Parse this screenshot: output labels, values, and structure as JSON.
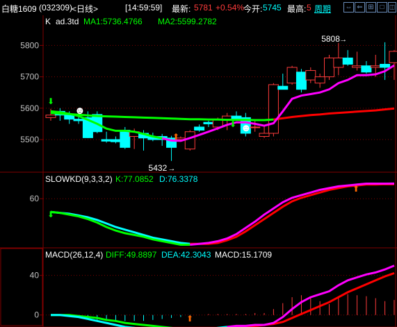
{
  "header": {
    "symbol": "白糖1609",
    "code": "(032309)",
    "period_tab": "<日线>",
    "time": "[14:59:59]",
    "latest_label": "最新:",
    "latest_value": "5781",
    "change": "+0.54%",
    "open_label": "今开:",
    "open_value": "5745",
    "high_label": "最高:",
    "high_value": "5",
    "period_link": "周期",
    "window_icons": [
      "arrows-left-right-icon",
      "back-icon",
      "grid-icon",
      "square-icon",
      "restore-icon",
      "close-icon"
    ]
  },
  "colors": {
    "up": "#ff3b3b",
    "down": "#00ffff",
    "ma1": "#ff00ff",
    "ma2": "#ff0000",
    "k": "#ff00ff",
    "d": "#00ffff",
    "diff": "#ff00ff",
    "dea": "#ff0000",
    "grid": "#800000",
    "axis_text": "#c0c0c0",
    "label_yellow": "#ffff00",
    "label_green": "#00ff00"
  },
  "chart_data": [
    {
      "type": "candlestick",
      "title": "K",
      "legend": {
        "name": "K",
        "sub": "ad.3td",
        "ma1_label": "MA1:5736.4766",
        "ma2_label": "MA2:5599.2782"
      },
      "y_ticks": [
        5500,
        5600,
        5700,
        5800
      ],
      "ylim": [
        5405,
        5865
      ],
      "annotations": [
        {
          "text": "5808",
          "value": 5808,
          "index": 32
        },
        {
          "text": "5432",
          "value": 5432,
          "index": 13
        }
      ],
      "candles": [
        {
          "o": 5570,
          "h": 5598,
          "l": 5560,
          "c": 5578
        },
        {
          "o": 5590,
          "h": 5600,
          "l": 5560,
          "c": 5578
        },
        {
          "o": 5580,
          "h": 5590,
          "l": 5550,
          "c": 5565
        },
        {
          "o": 5565,
          "h": 5575,
          "l": 5550,
          "c": 5560
        },
        {
          "o": 5570,
          "h": 5590,
          "l": 5505,
          "c": 5506
        },
        {
          "o": 5580,
          "h": 5590,
          "l": 5520,
          "c": 5525
        },
        {
          "o": 5500,
          "h": 5525,
          "l": 5490,
          "c": 5495
        },
        {
          "o": 5500,
          "h": 5510,
          "l": 5488,
          "c": 5493
        },
        {
          "o": 5530,
          "h": 5540,
          "l": 5470,
          "c": 5475
        },
        {
          "o": 5510,
          "h": 5535,
          "l": 5470,
          "c": 5525
        },
        {
          "o": 5520,
          "h": 5530,
          "l": 5465,
          "c": 5505
        },
        {
          "o": 5510,
          "h": 5522,
          "l": 5495,
          "c": 5500
        },
        {
          "o": 5510,
          "h": 5518,
          "l": 5480,
          "c": 5500
        },
        {
          "o": 5505,
          "h": 5512,
          "l": 5432,
          "c": 5475
        },
        {
          "o": 5500,
          "h": 5510,
          "l": 5495,
          "c": 5505
        },
        {
          "o": 5470,
          "h": 5530,
          "l": 5465,
          "c": 5525
        },
        {
          "o": 5540,
          "h": 5548,
          "l": 5525,
          "c": 5530
        },
        {
          "o": 5555,
          "h": 5560,
          "l": 5540,
          "c": 5550
        },
        {
          "o": 5540,
          "h": 5570,
          "l": 5530,
          "c": 5565
        },
        {
          "o": 5565,
          "h": 5585,
          "l": 5530,
          "c": 5575
        },
        {
          "o": 5575,
          "h": 5590,
          "l": 5560,
          "c": 5565
        },
        {
          "o": 5570,
          "h": 5585,
          "l": 5510,
          "c": 5520
        },
        {
          "o": 5540,
          "h": 5560,
          "l": 5525,
          "c": 5540
        },
        {
          "o": 5510,
          "h": 5545,
          "l": 5505,
          "c": 5520
        },
        {
          "o": 5520,
          "h": 5680,
          "l": 5510,
          "c": 5675
        },
        {
          "o": 5670,
          "h": 5710,
          "l": 5660,
          "c": 5660
        },
        {
          "o": 5680,
          "h": 5735,
          "l": 5675,
          "c": 5730
        },
        {
          "o": 5715,
          "h": 5725,
          "l": 5650,
          "c": 5660
        },
        {
          "o": 5690,
          "h": 5730,
          "l": 5680,
          "c": 5720
        },
        {
          "o": 5680,
          "h": 5710,
          "l": 5665,
          "c": 5700
        },
        {
          "o": 5700,
          "h": 5770,
          "l": 5690,
          "c": 5760
        },
        {
          "o": 5730,
          "h": 5808,
          "l": 5705,
          "c": 5760
        },
        {
          "o": 5760,
          "h": 5785,
          "l": 5735,
          "c": 5740
        },
        {
          "o": 5730,
          "h": 5780,
          "l": 5720,
          "c": 5735
        },
        {
          "o": 5735,
          "h": 5750,
          "l": 5710,
          "c": 5715
        },
        {
          "o": 5730,
          "h": 5770,
          "l": 5700,
          "c": 5735
        },
        {
          "o": 5740,
          "h": 5810,
          "l": 5690,
          "c": 5730
        },
        {
          "o": 5745,
          "h": 5785,
          "l": 5690,
          "c": 5781
        }
      ],
      "ma1": [
        5590,
        5587,
        5582,
        5575,
        5563,
        5550,
        5535,
        5528,
        5528,
        5525,
        5518,
        5510,
        5504,
        5497,
        5496,
        5505,
        5515,
        5525,
        5536,
        5547,
        5555,
        5555,
        5550,
        5544,
        5552,
        5590,
        5630,
        5640,
        5645,
        5650,
        5660,
        5680,
        5690,
        5705,
        5705,
        5708,
        5718,
        5736.48
      ],
      "ma2": [
        5585,
        5583,
        5581,
        5579,
        5577,
        5575,
        5574,
        5573,
        5572,
        5571,
        5570,
        5569,
        5568,
        5567,
        5566,
        5565,
        5565,
        5564,
        5564,
        5563,
        5563,
        5563,
        5562,
        5562,
        5564,
        5568,
        5572,
        5575,
        5578,
        5580,
        5583,
        5585,
        5587,
        5589,
        5591,
        5593,
        5596,
        5599.28
      ]
    },
    {
      "type": "line",
      "title": "SLOWKD(9,3,3,2)",
      "legend": {
        "name": "SLOWKD(9,3,3,2)",
        "k_label": "K:77.0852",
        "d_label": "D:76.3378"
      },
      "y_ticks": [
        60
      ],
      "ylim": [
        6,
        79
      ],
      "series": [
        {
          "name": "K",
          "values": [
            45,
            44,
            42,
            40,
            37,
            33,
            28,
            24,
            21,
            19,
            17,
            14,
            12,
            10,
            8,
            8,
            9,
            10,
            12,
            15,
            20,
            27,
            34,
            42,
            49,
            56,
            61,
            64,
            67,
            70,
            72,
            74,
            75,
            76,
            77,
            77,
            77,
            77.09
          ]
        },
        {
          "name": "D",
          "values": [
            45,
            44,
            43,
            41,
            39,
            36,
            32,
            28,
            25,
            22,
            19,
            16,
            14,
            12,
            10,
            9,
            9,
            9,
            10,
            13,
            17,
            23,
            30,
            37,
            44,
            51,
            57,
            61,
            64,
            67,
            70,
            72,
            74,
            75,
            76,
            76,
            76.5,
            76.34
          ]
        }
      ]
    },
    {
      "type": "line",
      "title": "MACD(26,12,4)",
      "legend": {
        "name": "MACD(26,12,4)",
        "diff_label": "DIFF:49.8897",
        "dea_label": "DEA:42.3043",
        "macd_label": "MACD:15.1709"
      },
      "y_ticks": [
        0,
        40
      ],
      "ylim": [
        -10,
        58
      ],
      "series": [
        {
          "name": "DIFF",
          "values": [
            0,
            0,
            -1,
            -2,
            -4,
            -6,
            -8,
            -10,
            -12,
            -13,
            -14,
            -15,
            -15,
            -16,
            -16,
            -16,
            -15,
            -14,
            -13,
            -12,
            -11,
            -11,
            -10,
            -10,
            -8,
            -2,
            6,
            13,
            18,
            21,
            24,
            30,
            35,
            38,
            41,
            43,
            46,
            49.89
          ]
        },
        {
          "name": "DEA",
          "values": [
            0,
            0,
            0,
            -1,
            -2,
            -3,
            -5,
            -6,
            -8,
            -9,
            -10,
            -11,
            -12,
            -13,
            -14,
            -14,
            -14,
            -14,
            -14,
            -13,
            -13,
            -12,
            -11,
            -10,
            -9,
            -7,
            -3,
            1,
            5,
            9,
            13,
            18,
            23,
            27,
            31,
            35,
            39,
            42.3
          ]
        },
        {
          "name": "MACD",
          "values": [
            0,
            0,
            -1,
            -2,
            -3,
            -5,
            -5,
            -6,
            -6,
            -6,
            -6,
            -5,
            -4,
            -3,
            -2,
            -1,
            0,
            1,
            1,
            1,
            1,
            1,
            2,
            2,
            6,
            12,
            18,
            20,
            18,
            14,
            11,
            19,
            21,
            20,
            19,
            17,
            14,
            15.17
          ]
        }
      ]
    }
  ]
}
